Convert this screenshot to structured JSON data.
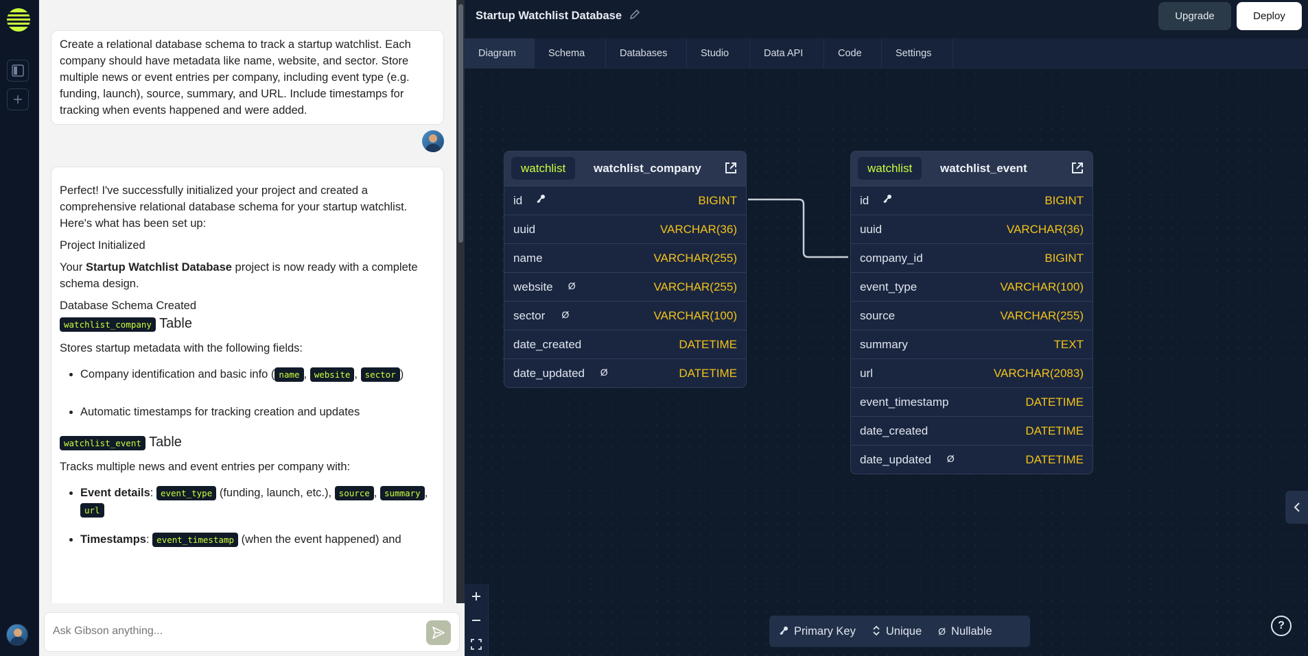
{
  "colors": {
    "accent": "#c9ff3d",
    "type_color": "#f3c319",
    "background": "#0f1a2b"
  },
  "chat": {
    "user_message": "Create a relational database schema to track a startup watchlist. Each company should have metadata like name, website, and sector. Store multiple news or event entries per company, including event type (e.g. funding, launch), source, summary, and URL. Include timestamps for tracking when events happened and were added.",
    "ai": {
      "intro": "Perfect! I've successfully initialized your project and created a comprehensive relational database schema for your startup watchlist. Here's what has been set up:",
      "project_initialized": "Project Initialized",
      "your_prefix": "Your ",
      "project_name": "Startup Watchlist Database",
      "ready_suffix": " project is now ready with a complete schema design.",
      "schema_created": "Database Schema Created",
      "company_code": "watchlist_company",
      "table_word": " Table",
      "company_desc": "Stores startup metadata with the following fields:",
      "company_bullet1_prefix": "Company identification and basic info (",
      "company_fields": [
        "name",
        "website",
        "sector"
      ],
      "comma": ", ",
      "close_paren": ")",
      "company_bullet2": "Automatic timestamps for tracking creation and updates",
      "event_code": "watchlist_event",
      "event_desc": "Tracks multiple news and event entries per company with:",
      "event_details_label": "Event details",
      "colon": ": ",
      "event_type_code": "event_type",
      "event_type_note": " (funding, launch, etc.), ",
      "source_code": "source",
      "summary_code": "summary",
      "url_code": "url",
      "timestamps_label": "Timestamps",
      "event_timestamp_code": "event_timestamp",
      "timestamps_note": " (when the event happened) and"
    },
    "input_placeholder": "Ask Gibson anything..."
  },
  "header": {
    "project_title": "Startup Watchlist Database",
    "upgrade_label": "Upgrade",
    "deploy_label": "Deploy"
  },
  "tabs": [
    "Diagram",
    "Schema",
    "Databases",
    "Studio",
    "Data API",
    "Code",
    "Settings"
  ],
  "tables": {
    "company": {
      "schema": "watchlist",
      "name": "watchlist_company",
      "columns": [
        {
          "name": "id",
          "badge": "key",
          "type": "BIGINT"
        },
        {
          "name": "uuid",
          "badge": "",
          "type": "VARCHAR(36)"
        },
        {
          "name": "name",
          "badge": "",
          "type": "VARCHAR(255)"
        },
        {
          "name": "website",
          "badge": "Ø",
          "type": "VARCHAR(255)"
        },
        {
          "name": "sector",
          "badge": "Ø",
          "type": "VARCHAR(100)"
        },
        {
          "name": "date_created",
          "badge": "",
          "type": "DATETIME"
        },
        {
          "name": "date_updated",
          "badge": "Ø",
          "type": "DATETIME"
        }
      ]
    },
    "event": {
      "schema": "watchlist",
      "name": "watchlist_event",
      "columns": [
        {
          "name": "id",
          "badge": "key",
          "type": "BIGINT"
        },
        {
          "name": "uuid",
          "badge": "",
          "type": "VARCHAR(36)"
        },
        {
          "name": "company_id",
          "badge": "",
          "type": "BIGINT"
        },
        {
          "name": "event_type",
          "badge": "",
          "type": "VARCHAR(100)"
        },
        {
          "name": "source",
          "badge": "",
          "type": "VARCHAR(255)"
        },
        {
          "name": "summary",
          "badge": "",
          "type": "TEXT"
        },
        {
          "name": "url",
          "badge": "",
          "type": "VARCHAR(2083)"
        },
        {
          "name": "event_timestamp",
          "badge": "",
          "type": "DATETIME"
        },
        {
          "name": "date_created",
          "badge": "",
          "type": "DATETIME"
        },
        {
          "name": "date_updated",
          "badge": "Ø",
          "type": "DATETIME"
        }
      ]
    }
  },
  "legend": {
    "primary_key": "Primary Key",
    "unique": "Unique",
    "nullable": "Nullable",
    "nullable_symbol": "Ø"
  },
  "help_symbol": "?"
}
